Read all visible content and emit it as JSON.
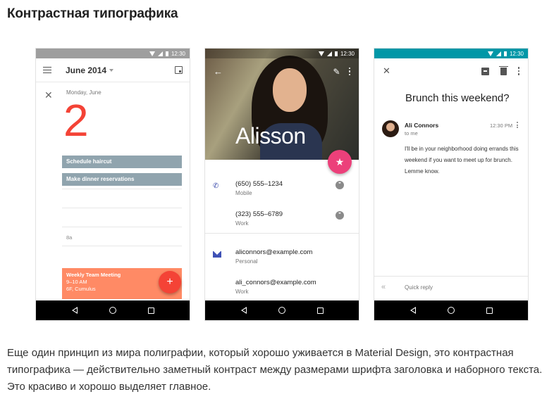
{
  "heading": "Контрастная типографика",
  "paragraph": "Еще один принцип из мира полиграфии, который хорошо уживается в Material Design, это контрастная типографика — действительно заметный контраст между размерами шрифта заголовка и наборного текста. Это красиво и хорошо выделяет главное.",
  "status_time": "12:30",
  "calendar": {
    "status_color": "#9e9e9e",
    "month": "June 2014",
    "day_label": "Monday, June",
    "day_number": "2",
    "events": [
      "Schedule haircut",
      "Make dinner reservations"
    ],
    "time_slot": "8a",
    "meeting": {
      "title": "Weekly Team Meeting",
      "time": "9–10 AM",
      "location": "6F, Cumulus"
    },
    "fab": "+"
  },
  "contact": {
    "name": "Alisson",
    "phones": [
      {
        "number": "(650) 555–1234",
        "type": "Mobile"
      },
      {
        "number": "(323) 555–6789",
        "type": "Work"
      }
    ],
    "emails": [
      {
        "address": "aliconnors@example.com",
        "type": "Personal"
      },
      {
        "address": "ali_connors@example.com",
        "type": "Work"
      }
    ],
    "accent_color": "#ec407a"
  },
  "email": {
    "status_color": "#0097a7",
    "subject": "Brunch this weekend?",
    "sender": "Ali Connors",
    "recipient": "to me",
    "time": "12:30 PM",
    "body": "I'll be in your neighborhood doing errands this weekend if you want to meet up for brunch. Lemme know.",
    "quick_reply": "Quick reply"
  }
}
